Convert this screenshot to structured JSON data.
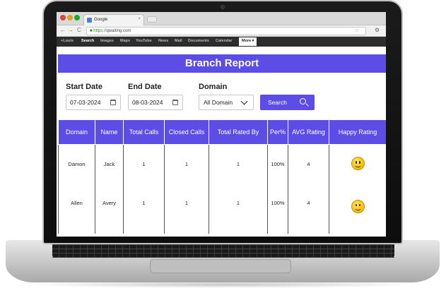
{
  "browser": {
    "tab_title": "Google",
    "tab_close": "×",
    "url_scheme": "https://",
    "url_host": "qwaiting.com",
    "nav_back": "←",
    "nav_forward": "→",
    "nav_reload": "C",
    "star": "☆",
    "wrench": "⚙"
  },
  "google_bar": {
    "items": [
      "+Louis",
      "Search",
      "Images",
      "Maps",
      "YouTube",
      "News",
      "Mail",
      "Documents",
      "Calendar"
    ],
    "active_index": 1,
    "more": "More ▾"
  },
  "report": {
    "title": "Branch Report",
    "filters": {
      "start_date_label": "Start Date",
      "start_date_value": "07-03-2024",
      "end_date_label": "End Date",
      "end_date_value": "08-03-2024",
      "domain_label": "Domain",
      "domain_value": "All Domain",
      "search_label": "Search"
    },
    "columns": [
      "Domain",
      "Name",
      "Total Calls",
      "Closed Calls",
      "Total Rated By",
      "Per%",
      "AVG Rating",
      "Happy Rating"
    ],
    "rows": [
      {
        "domain": "Damon",
        "name": "Jack",
        "total_calls": "1",
        "closed_calls": "1",
        "total_rated_by": "1",
        "per": "100%",
        "avg_rating": "4",
        "happy_rating_icon": "smiley-icon"
      },
      {
        "domain": "Allen",
        "name": "Avery",
        "total_calls": "1",
        "closed_calls": "1",
        "total_rated_by": "1",
        "per": "100%",
        "avg_rating": "4",
        "happy_rating_icon": "smiley-icon"
      }
    ]
  },
  "colors": {
    "accent": "#5b4de6",
    "smiley": "#f5b800"
  }
}
